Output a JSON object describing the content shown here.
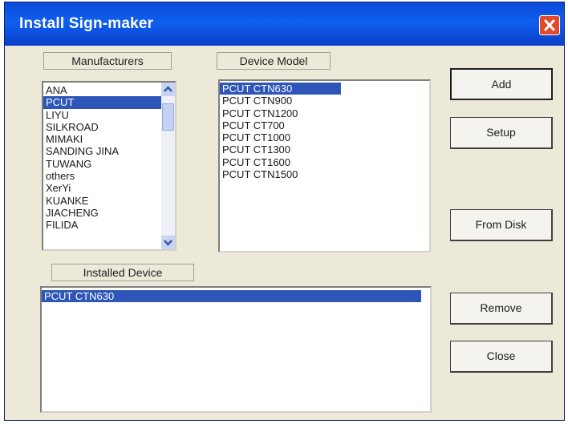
{
  "window": {
    "title": "Install Sign-maker"
  },
  "manufacturers": {
    "label": "Manufacturers",
    "items": [
      "ANA",
      "PCUT",
      "LIYU",
      "SILKROAD",
      "MIMAKI",
      "SANDING JINA",
      "TUWANG",
      "others",
      "XerYi",
      "KUANKE",
      "JIACHENG",
      "FILIDA"
    ],
    "selected_index": 1
  },
  "device_model": {
    "label": "Device Model",
    "items": [
      "PCUT CTN630",
      "PCUT CTN900",
      "PCUT CTN1200",
      "PCUT CT700",
      "PCUT CT1000",
      "PCUT CT1300",
      "PCUT CT1600",
      "PCUT CTN1500"
    ],
    "selected_index": 0
  },
  "installed_device": {
    "label": "Installed Device",
    "items": [
      "PCUT CTN630"
    ],
    "selected_index": 0
  },
  "buttons": {
    "add": "Add",
    "setup": "Setup",
    "from_disk": "From Disk",
    "remove": "Remove",
    "close": "Close"
  },
  "colors": {
    "titlebar": "#0a49d8",
    "selection": "#2e56b8",
    "close": "#e24b2a",
    "dialog": "#ece9d8"
  },
  "icons": {
    "close": "close-icon",
    "scroll_up": "chevron-up-icon",
    "scroll_down": "chevron-down-icon"
  }
}
